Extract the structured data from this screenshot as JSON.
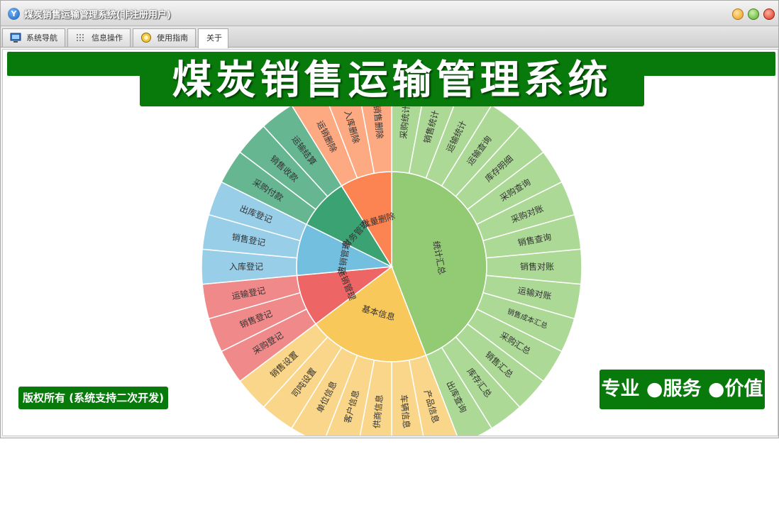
{
  "window": {
    "title": "煤炭销售运输管理系统(非注册用户)",
    "app_icon_glyph": "Y"
  },
  "tabs": [
    {
      "label": "系统导航",
      "icon": "monitor-icon"
    },
    {
      "label": "信息操作",
      "icon": "grid-icon"
    },
    {
      "label": "使用指南",
      "icon": "guide-icon"
    },
    {
      "label": "关于",
      "icon": ""
    }
  ],
  "banner": {
    "title": "煤炭销售运输管理系统"
  },
  "footer": {
    "copyright": "版权所有 (系统支持二次开发)",
    "slogan": "专业 ●服务 ●价值"
  },
  "colors": {
    "brand_green": "#077a0b",
    "green": "#93ca74",
    "green_light": "#acd996",
    "yellow": "#f9c85b",
    "yellow_light": "#fad68a",
    "red": "#ee6565",
    "red_light": "#f08a8a",
    "blue": "#73bfe0",
    "blue_light": "#98cee7",
    "teal": "#3ba273",
    "teal_light": "#66b692",
    "orange": "#fc8452",
    "orange_light": "#fda981"
  },
  "chart_data": {
    "type": "sunburst",
    "title": "",
    "inner": [
      {
        "label": "统计汇总",
        "color": "green",
        "children": [
          "采购统计",
          "销售统计",
          "运输统计",
          "运输查询",
          "库存明细",
          "采购查询",
          "采购对账",
          "销售查询",
          "销售对账",
          "运输对账",
          "销售成本汇总",
          "采购汇总",
          "销售汇总",
          "库存汇总",
          "出库查询"
        ]
      },
      {
        "label": "基本信息",
        "color": "yellow",
        "children": [
          "产品信息",
          "车辆信息",
          "供商信息",
          "客户信息",
          "单位信息",
          "司吨设置",
          "销售设置"
        ]
      },
      {
        "label": "运销管理",
        "color": "red",
        "children": [
          "采购登记",
          "销售登记",
          "运输登记"
        ]
      },
      {
        "label": "进销管理",
        "color": "blue",
        "children": [
          "入库登记",
          "销售登记",
          "出库登记"
        ]
      },
      {
        "label": "财务管理",
        "color": "teal",
        "children": [
          "采购付款",
          "销售收款",
          "运输结算"
        ]
      },
      {
        "label": "批量删除",
        "color": "orange",
        "children": [
          "运销删除",
          "入库删除",
          "销售删除"
        ]
      }
    ]
  }
}
